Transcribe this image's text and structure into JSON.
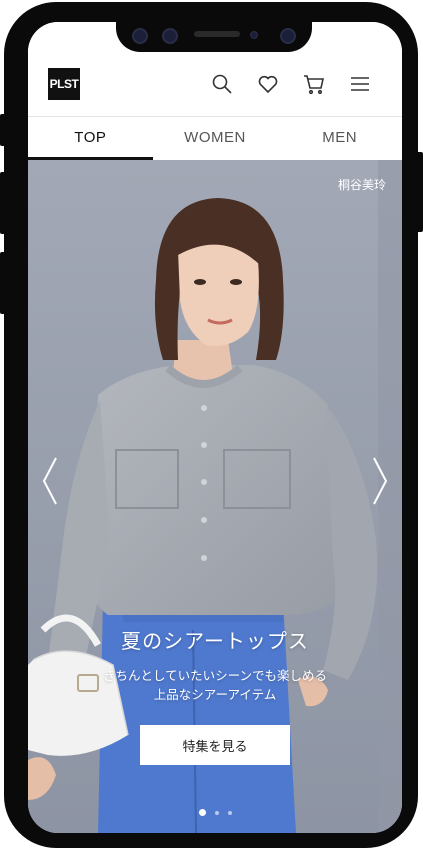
{
  "brand": {
    "logo_text": "PLST"
  },
  "header_icons": [
    "search-icon",
    "heart-icon",
    "cart-icon",
    "menu-icon"
  ],
  "tabs": [
    {
      "label": "TOP",
      "active": true
    },
    {
      "label": "WOMEN",
      "active": false
    },
    {
      "label": "MEN",
      "active": false
    }
  ],
  "hero": {
    "model_credit": "桐谷美玲",
    "headline": "夏のシアートップス",
    "subline_1": "きちんとしていたいシーンでも楽しめる",
    "subline_2": "上品なシアーアイテム",
    "cta_label": "特集を見る",
    "slide_count": 3,
    "active_slide": 1
  },
  "colors": {
    "accent": "#111111",
    "hero_bg": "#9ea4b1",
    "cardigan": "#a9aeb6",
    "pants": "#4f79cf"
  }
}
